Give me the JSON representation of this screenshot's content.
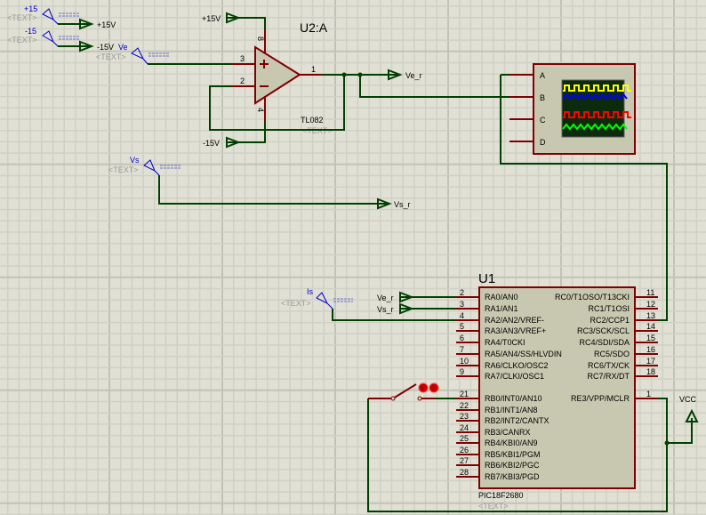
{
  "colors": {
    "background": "#e0e0d4",
    "wire": "#004000",
    "pin": "#800000",
    "component_fill": "#c8c8b0",
    "generator": "#0000d0"
  },
  "generators": {
    "plus15": {
      "name": "+15",
      "text": "<TEXT>"
    },
    "minus15": {
      "name": "-15",
      "text": "<TEXT>"
    },
    "ve": {
      "name": "Ve",
      "text": "<TEXT>"
    },
    "vs": {
      "name": "Vs",
      "text": "<TEXT>"
    },
    "is": {
      "name": "Is",
      "text": "<TEXT>"
    }
  },
  "terminals": {
    "t_p15": "+15V",
    "t_m15": "-15V",
    "op_p15": "+15V",
    "op_m15": "-15V",
    "ve_r_out": "Ve_r",
    "vs_r_out": "Vs_r",
    "ve_r_in": "Ve_r",
    "vs_r_in": "Vs_r",
    "vcc": "VCC"
  },
  "opamp": {
    "ref": "U2:A",
    "part": "TL082",
    "text": "<TEXT>",
    "pins": {
      "p8": "8",
      "p4": "4",
      "p3": "3",
      "p2": "2",
      "p1": "1"
    }
  },
  "scope": {
    "channels": [
      "A",
      "B",
      "C",
      "D"
    ],
    "trace_colors": [
      "#ffff00",
      "#0000ff",
      "#ff0000",
      "#00ff00"
    ]
  },
  "mcu": {
    "ref": "U1",
    "part": "PIC18F2680",
    "text": "<TEXT>",
    "left_pins": [
      {
        "num": "2",
        "name": "RA0/AN0"
      },
      {
        "num": "3",
        "name": "RA1/AN1"
      },
      {
        "num": "4",
        "name": "RA2/AN2/VREF-"
      },
      {
        "num": "5",
        "name": "RA3/AN3/VREF+"
      },
      {
        "num": "6",
        "name": "RA4/T0CKI"
      },
      {
        "num": "7",
        "name": "RA5/AN4/SS/HLVDIN"
      },
      {
        "num": "10",
        "name": "RA6/CLKO/OSC2"
      },
      {
        "num": "9",
        "name": "RA7/CLKI/OSC1"
      },
      {
        "num": "21",
        "name": "RB0/INT0/AN10"
      },
      {
        "num": "22",
        "name": "RB1/INT1/AN8"
      },
      {
        "num": "23",
        "name": "RB2/INT2/CANTX"
      },
      {
        "num": "24",
        "name": "RB3/CANRX"
      },
      {
        "num": "25",
        "name": "RB4/KBI0/AN9"
      },
      {
        "num": "26",
        "name": "RB5/KBI1/PGM"
      },
      {
        "num": "27",
        "name": "RB6/KBI2/PGC"
      },
      {
        "num": "28",
        "name": "RB7/KBI3/PGD"
      }
    ],
    "right_pins": [
      {
        "num": "11",
        "name": "RC0/T1OSO/T13CKI"
      },
      {
        "num": "12",
        "name": "RC1/T1OSI"
      },
      {
        "num": "13",
        "name": "RC2/CCP1"
      },
      {
        "num": "14",
        "name": "RC3/SCK/SCL"
      },
      {
        "num": "15",
        "name": "RC4/SDI/SDA"
      },
      {
        "num": "16",
        "name": "RC5/SDO"
      },
      {
        "num": "17",
        "name": "RC6/TX/CK"
      },
      {
        "num": "18",
        "name": "RC7/RX/DT"
      },
      {
        "num": "1",
        "name": "RE3/VPP/MCLR"
      }
    ]
  }
}
